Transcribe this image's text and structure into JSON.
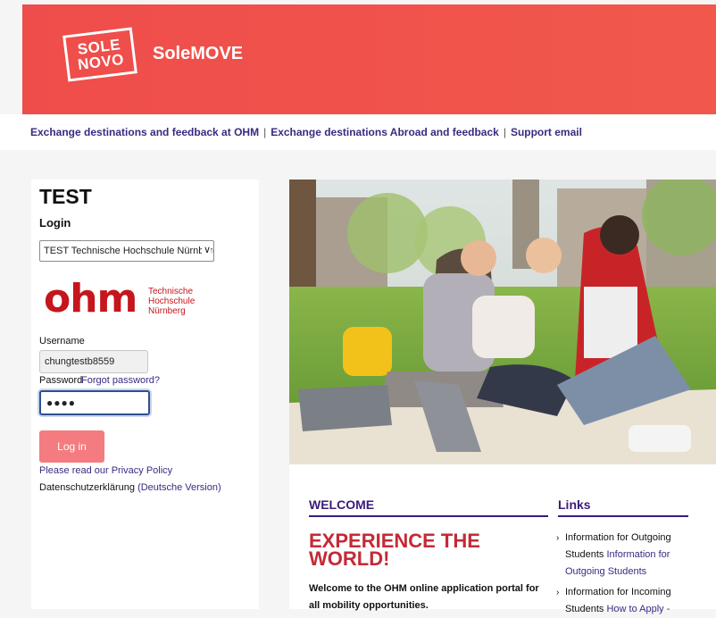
{
  "header": {
    "logo_line1": "SOLE",
    "logo_line2": "NOVO",
    "app_name": "SoleMOVE"
  },
  "nav_links": [
    "Exchange destinations and feedback at OHM",
    "Exchange destinations Abroad and feedback",
    "Support email"
  ],
  "login": {
    "site_title": "TEST",
    "heading": "Login",
    "institution_selected": "TEST Technische Hochschule Nürnberg",
    "institution_logo_word": "ohm",
    "institution_logo_sub": [
      "Technische",
      "Hochschule",
      "Nürnberg"
    ],
    "username_label": "Username",
    "username_value": "chungtestb8559",
    "password_label": "Password",
    "forgot_password": "Forgot password?",
    "password_mask": "●●●●",
    "login_button": "Log in",
    "privacy_link": "Please read our Privacy Policy",
    "dsk_text": "Datenschutzerklärung",
    "dsk_link": "(Deutsche Version)"
  },
  "content": {
    "welcome_heading": "WELCOME",
    "headline": "EXPERIENCE THE WORLD!",
    "welcome_text": "Welcome to the OHM online application portal for all mobility opportunities.",
    "links_heading": "Links",
    "links": [
      {
        "text": "Information for Outgoing Students",
        "link": "Information for Outgoing Students"
      },
      {
        "text": "Information for Incoming Students",
        "link": "How to Apply -"
      }
    ]
  },
  "colors": {
    "brand_red": "#ef4d4b",
    "link_purple": "#3a2a82",
    "heading_purple": "#3a1c7a",
    "headline_red": "#c32a36",
    "button_pink": "#f47b7f"
  }
}
